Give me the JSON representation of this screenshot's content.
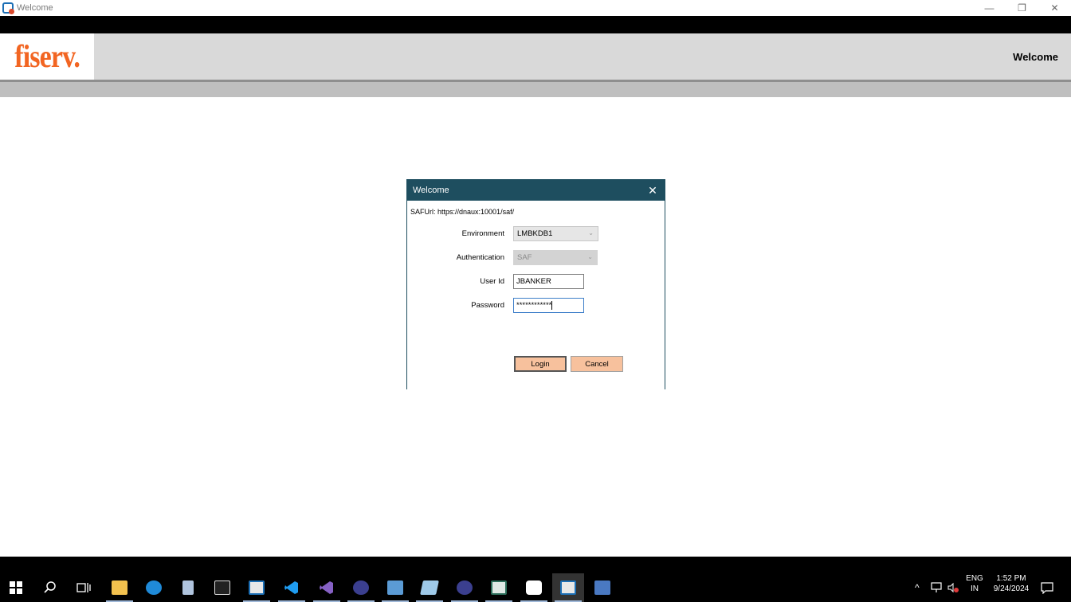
{
  "window": {
    "title": "Welcome",
    "minimize": "—",
    "maximize": "❐",
    "close": "✕"
  },
  "header": {
    "logo": "fiserv.",
    "title": "Welcome"
  },
  "dialog": {
    "title": "Welcome",
    "close": "✕",
    "saf_url": "SAFUrl: https://dnaux:10001/saf/",
    "environment": {
      "label": "Environment",
      "value": "LMBKDB1",
      "arrow": "⌄"
    },
    "authentication": {
      "label": "Authentication",
      "value": "SAF",
      "arrow": "⌄"
    },
    "user_id": {
      "label": "User Id",
      "value": "JBANKER"
    },
    "password": {
      "label": "Password",
      "value": "************"
    },
    "login_label": "Login",
    "cancel_label": "Cancel"
  },
  "taskbar": {
    "language_line1": "ENG",
    "language_line2": "IN",
    "time": "1:52 PM",
    "date": "9/24/2024",
    "chevron": "^"
  },
  "colors": {
    "logo": "#f26522",
    "dialog_header": "#1e4e5f",
    "button": "#f7c19d"
  }
}
